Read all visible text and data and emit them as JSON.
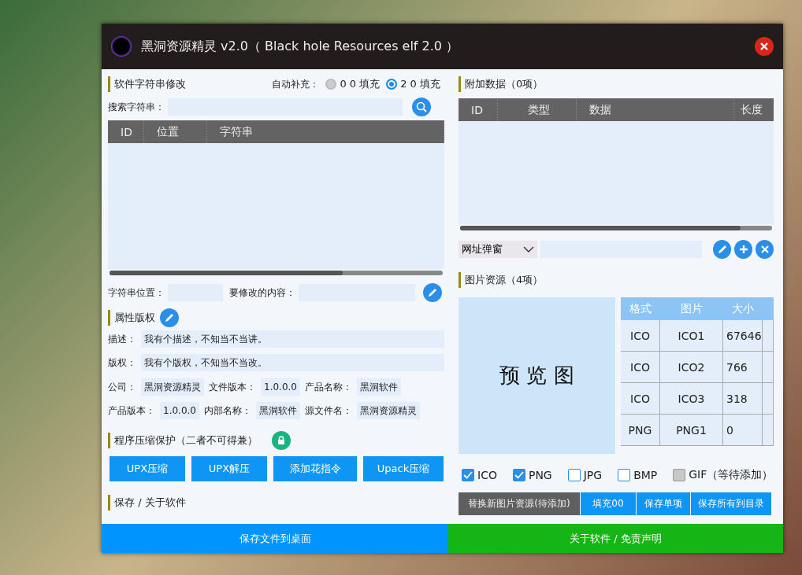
{
  "window": {
    "title": "黑洞资源精灵 v2.0（ Black hole Resources elf 2.0 ）"
  },
  "strings": {
    "heading": "软件字符串修改",
    "auto_fill_label": "自动补充：",
    "fill_options": [
      {
        "label": "0 0 填充",
        "selected": false
      },
      {
        "label": "2 0 填充",
        "selected": true
      }
    ],
    "search_label": "搜索字符串：",
    "columns": [
      "ID",
      "位置",
      "字符串"
    ],
    "position_label": "字符串位置：",
    "content_label": "要修改的内容："
  },
  "properties": {
    "heading": "属性版权",
    "rows": [
      [
        {
          "label": "描述：",
          "value": "我有个描述，不知当不当讲。"
        }
      ],
      [
        {
          "label": "版权：",
          "value": "我有个版权，不知当不当改。"
        }
      ],
      [
        {
          "label": "公司：",
          "value": "黑洞资源精灵"
        },
        {
          "label": "文件版本：",
          "value": "1.0.0.0"
        },
        {
          "label": "产品名称：",
          "value": "黑洞软件"
        }
      ],
      [
        {
          "label": "产品版本：",
          "value": "1.0.0.0"
        },
        {
          "label": "内部名称：",
          "value": "黑洞软件"
        },
        {
          "label": "源文件名：",
          "value": "黑洞资源精灵"
        }
      ]
    ]
  },
  "compression": {
    "heading": "程序压缩保护（二者不可得兼）",
    "buttons": [
      "UPX压缩",
      "UPX解压",
      "添加花指令",
      "Upack压缩"
    ]
  },
  "save": {
    "heading": "保存 / 关于软件"
  },
  "extra_data": {
    "heading": "附加数据（0项）",
    "columns": [
      "ID",
      "类型",
      "数据",
      "长度"
    ],
    "dropdown": "网址弹窗"
  },
  "images": {
    "heading": "图片资源（4项）",
    "preview": "预 览 图",
    "columns": [
      "格式",
      "图片",
      "大小"
    ],
    "rows": [
      [
        "ICO",
        "ICO1",
        "67646"
      ],
      [
        "ICO",
        "ICO2",
        "766"
      ],
      [
        "ICO",
        "ICO3",
        "318"
      ],
      [
        "PNG",
        "PNG1",
        "0"
      ]
    ],
    "formats": [
      {
        "label": "ICO",
        "checked": true,
        "disabled": false
      },
      {
        "label": "PNG",
        "checked": true,
        "disabled": false
      },
      {
        "label": "JPG",
        "checked": false,
        "disabled": false
      },
      {
        "label": "BMP",
        "checked": false,
        "disabled": false
      },
      {
        "label": "GIF（等待添加）",
        "checked": false,
        "disabled": true
      }
    ],
    "buttons": [
      {
        "label": "替换新图片资源(待添加)",
        "disabled": true
      },
      {
        "label": "填充00",
        "disabled": false
      },
      {
        "label": "保存单项",
        "disabled": false
      },
      {
        "label": "保存所有到目录",
        "disabled": false
      }
    ]
  },
  "bottom_buttons": [
    {
      "label": "保存文件到桌面",
      "kind": "save"
    },
    {
      "label": "关于软件 / 免责声明",
      "kind": "about"
    }
  ]
}
